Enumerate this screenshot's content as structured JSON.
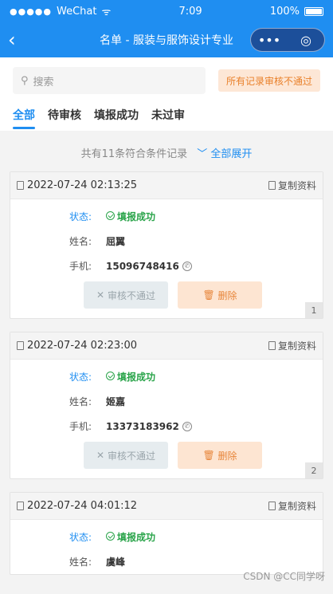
{
  "statusbar": {
    "carrier": "WeChat",
    "signal_dots": "●●●●●",
    "wifi": "ᯤ",
    "time": "7:09",
    "battery": "100%"
  },
  "navbar": {
    "title": "名单 - 服装与服饰设计专业",
    "back_icon": "‹",
    "more_icon": "•••",
    "close_icon": "◎"
  },
  "search": {
    "placeholder": "搜索",
    "icon": "⚲"
  },
  "reject_all_label": "所有记录审核不通过",
  "tabs": [
    {
      "label": "全部"
    },
    {
      "label": "待审核"
    },
    {
      "label": "填报成功"
    },
    {
      "label": "未过审"
    }
  ],
  "summary": {
    "text": "共有11条符合条件记录",
    "expand_label": "全部展开",
    "expand_icon": "﹀"
  },
  "labels": {
    "status": "状态:",
    "name": "姓名:",
    "phone": "手机:",
    "copy": "复制资料",
    "reject": "审核不通过",
    "delete": "删除",
    "reject_icon": "✕",
    "delete_icon": "🗑",
    "phone_icon": "✆"
  },
  "records": [
    {
      "time": "2022-07-24 02:13:25",
      "status": "填报成功",
      "name": "屈翼",
      "phone": "15096748416",
      "index": "1"
    },
    {
      "time": "2022-07-24 02:23:00",
      "status": "填报成功",
      "name": "姬嘉",
      "phone": "13373183962",
      "index": "2"
    },
    {
      "time": "2022-07-24 04:01:12",
      "status": "填报成功",
      "name": "虞峰",
      "phone": "",
      "index": ""
    }
  ],
  "watermark": "CSDN @CC同学呀"
}
